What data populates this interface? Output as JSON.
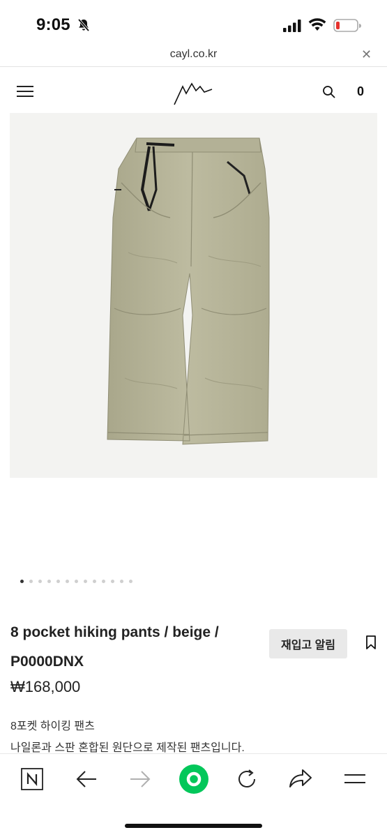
{
  "status_bar": {
    "time": "9:05"
  },
  "browser": {
    "url": "cayl.co.kr"
  },
  "site": {
    "cart_count": "0"
  },
  "product": {
    "title_line1": "8 pocket hiking pants / beige /",
    "title_line2": "P0000DNX",
    "price": "₩168,000",
    "restock_label": "재입고 알림",
    "description_line1": "8포켓 하이킹 팬츠",
    "description_line2": "나일론과 스판 혼합된 원단으로 제작된 팬츠입니다.",
    "image_color": "beige",
    "gallery": {
      "total_images": 13,
      "current_index": 1
    }
  },
  "colors": {
    "pants_beige": "#b9b79b",
    "toolbar_green": "#03c75a",
    "battery_red": "#e5322d"
  },
  "toolbar_icons": [
    "naver-n-icon",
    "back-arrow-icon",
    "forward-arrow-icon",
    "naver-green-circle-icon",
    "reload-icon",
    "share-icon",
    "menu-icon"
  ]
}
